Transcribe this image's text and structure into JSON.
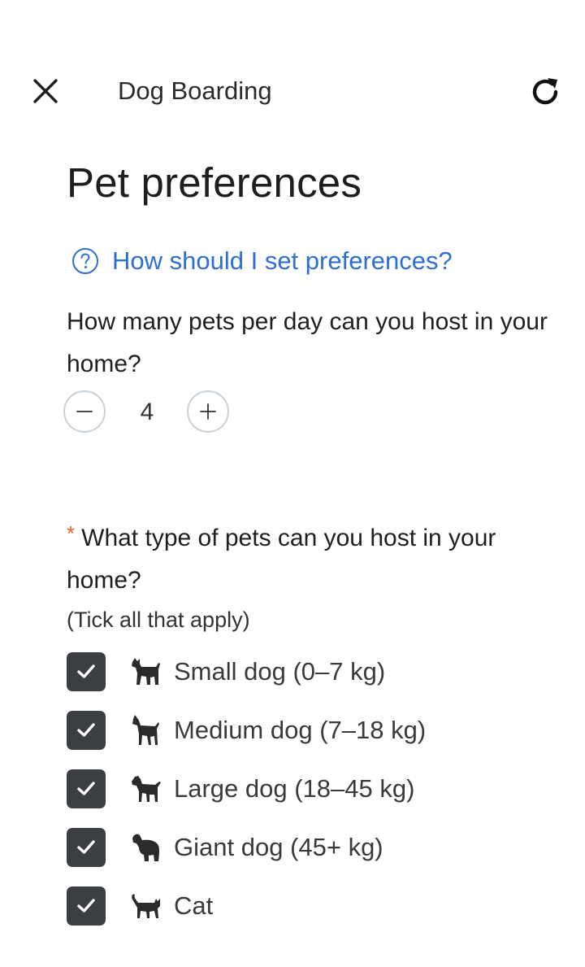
{
  "header": {
    "title": "Dog Boarding",
    "close_icon": "close-icon",
    "refresh_icon": "refresh-icon"
  },
  "page_title": "Pet preferences",
  "help_link": {
    "label": "How should I set preferences?",
    "icon": "question-circle-icon",
    "color": "#2f6fd1"
  },
  "pets_per_day": {
    "question": "How many pets per day can you host in your home?",
    "value": "4",
    "decrement_icon": "minus-icon",
    "increment_icon": "plus-icon"
  },
  "pet_types": {
    "required_marker": "*",
    "question": "What type of pets can you host in your home?",
    "hint": "(Tick all that apply)",
    "options": [
      {
        "label": "Small dog (0–7 kg)",
        "checked": true,
        "icon": "small-dog-icon"
      },
      {
        "label": "Medium dog (7–18 kg)",
        "checked": true,
        "icon": "medium-dog-icon"
      },
      {
        "label": "Large dog (18–45 kg)",
        "checked": true,
        "icon": "large-dog-icon"
      },
      {
        "label": "Giant dog (45+ kg)",
        "checked": true,
        "icon": "giant-dog-icon"
      },
      {
        "label": "Cat",
        "checked": true,
        "icon": "cat-icon"
      }
    ]
  },
  "colors": {
    "link": "#2f6fd1",
    "required": "#e0662c",
    "checkbox": "#3b3f44"
  }
}
